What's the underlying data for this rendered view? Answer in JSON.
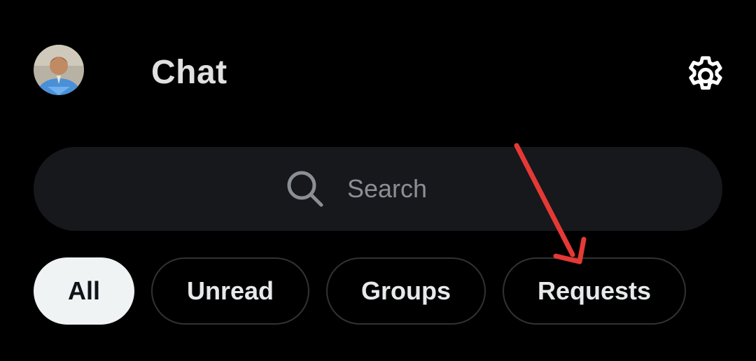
{
  "header": {
    "title": "Chat",
    "avatar_icon": "user-avatar",
    "settings_icon": "gear-icon"
  },
  "search": {
    "placeholder": "Search",
    "icon": "search-icon"
  },
  "tabs": [
    {
      "label": "All",
      "active": true
    },
    {
      "label": "Unread",
      "active": false
    },
    {
      "label": "Groups",
      "active": false
    },
    {
      "label": "Requests",
      "active": false
    }
  ],
  "annotation": {
    "type": "arrow",
    "color": "#e53935",
    "points_to": "Requests"
  },
  "colors": {
    "background": "#000000",
    "search_bg": "#16181c",
    "tab_border": "#2f3336",
    "active_tab_bg": "#eff3f4"
  }
}
